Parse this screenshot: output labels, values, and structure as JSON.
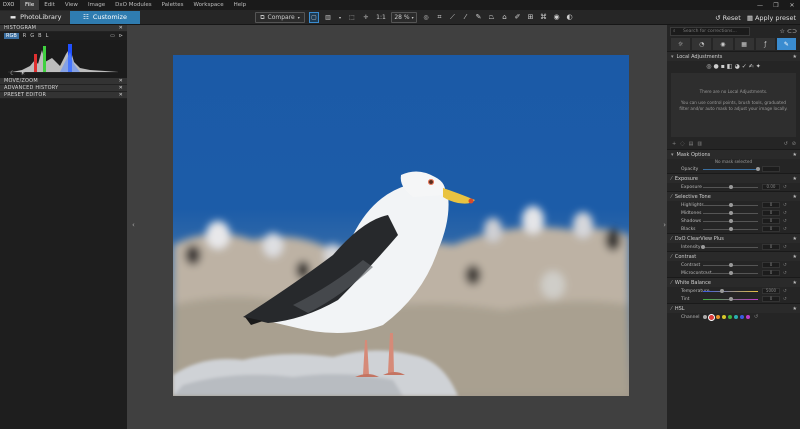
{
  "app": {
    "logo": "DXO"
  },
  "menu": [
    "File",
    "Edit",
    "View",
    "Image",
    "DxO Modules",
    "Palettes",
    "Workspace",
    "Help"
  ],
  "window_buttons": [
    "—",
    "❐",
    "✕"
  ],
  "tabs": {
    "photolibrary": "PhotoLibrary",
    "customize": "Customize"
  },
  "toolbar": {
    "compare": "Compare",
    "ratio": "1:1",
    "zoom": "28 %",
    "reset": "Reset",
    "apply_preset": "Apply preset"
  },
  "left_panel": {
    "histogram": {
      "title": "HISTOGRAM",
      "channels": [
        "RGB",
        "R",
        "G",
        "B",
        "L"
      ]
    },
    "collapsed": [
      "MOVE/ZOOM",
      "ADVANCED HISTORY",
      "PRESET EDITOR"
    ]
  },
  "right_panel": {
    "search_placeholder": "Search for corrections...",
    "local_adjustments": {
      "title": "Local Adjustments",
      "line1": "There are no Local Adjustments.",
      "line2": "You can use control points, brush tools, graduated",
      "line3": "filter and/or auto mask to adjust your image locally."
    },
    "mask_options": {
      "title": "Mask Options",
      "status": "No mask selected",
      "opacity_label": "Opacity"
    },
    "exposure": {
      "title": "Exposure",
      "label": "Exposure",
      "value": "0.00",
      "level": 0.5
    },
    "selective_tone": {
      "title": "Selective Tone",
      "rows": [
        {
          "label": "Highlights",
          "value": "0",
          "level": 0.5
        },
        {
          "label": "Midtones",
          "value": "0",
          "level": 0.5
        },
        {
          "label": "Shadows",
          "value": "0",
          "level": 0.5
        },
        {
          "label": "Blacks",
          "value": "0",
          "level": 0.5
        }
      ]
    },
    "clearview": {
      "title": "DxO ClearView Plus",
      "label": "Intensity",
      "value": "0",
      "level": 0
    },
    "contrast": {
      "title": "Contrast",
      "rows": [
        {
          "label": "Contrast",
          "value": "0",
          "level": 0.5
        },
        {
          "label": "Microcontrast",
          "value": "0",
          "level": 0.5
        }
      ]
    },
    "white_balance": {
      "title": "White Balance",
      "rows": [
        {
          "label": "Temperature",
          "value": "5000",
          "level": 0.35
        },
        {
          "label": "Tint",
          "value": "0",
          "level": 0.5
        }
      ]
    },
    "hsl": {
      "title": "HSL",
      "channel_label": "Channel"
    }
  },
  "colors": {
    "accent": "#2f7cb0",
    "sky": "#1c5aa6"
  }
}
